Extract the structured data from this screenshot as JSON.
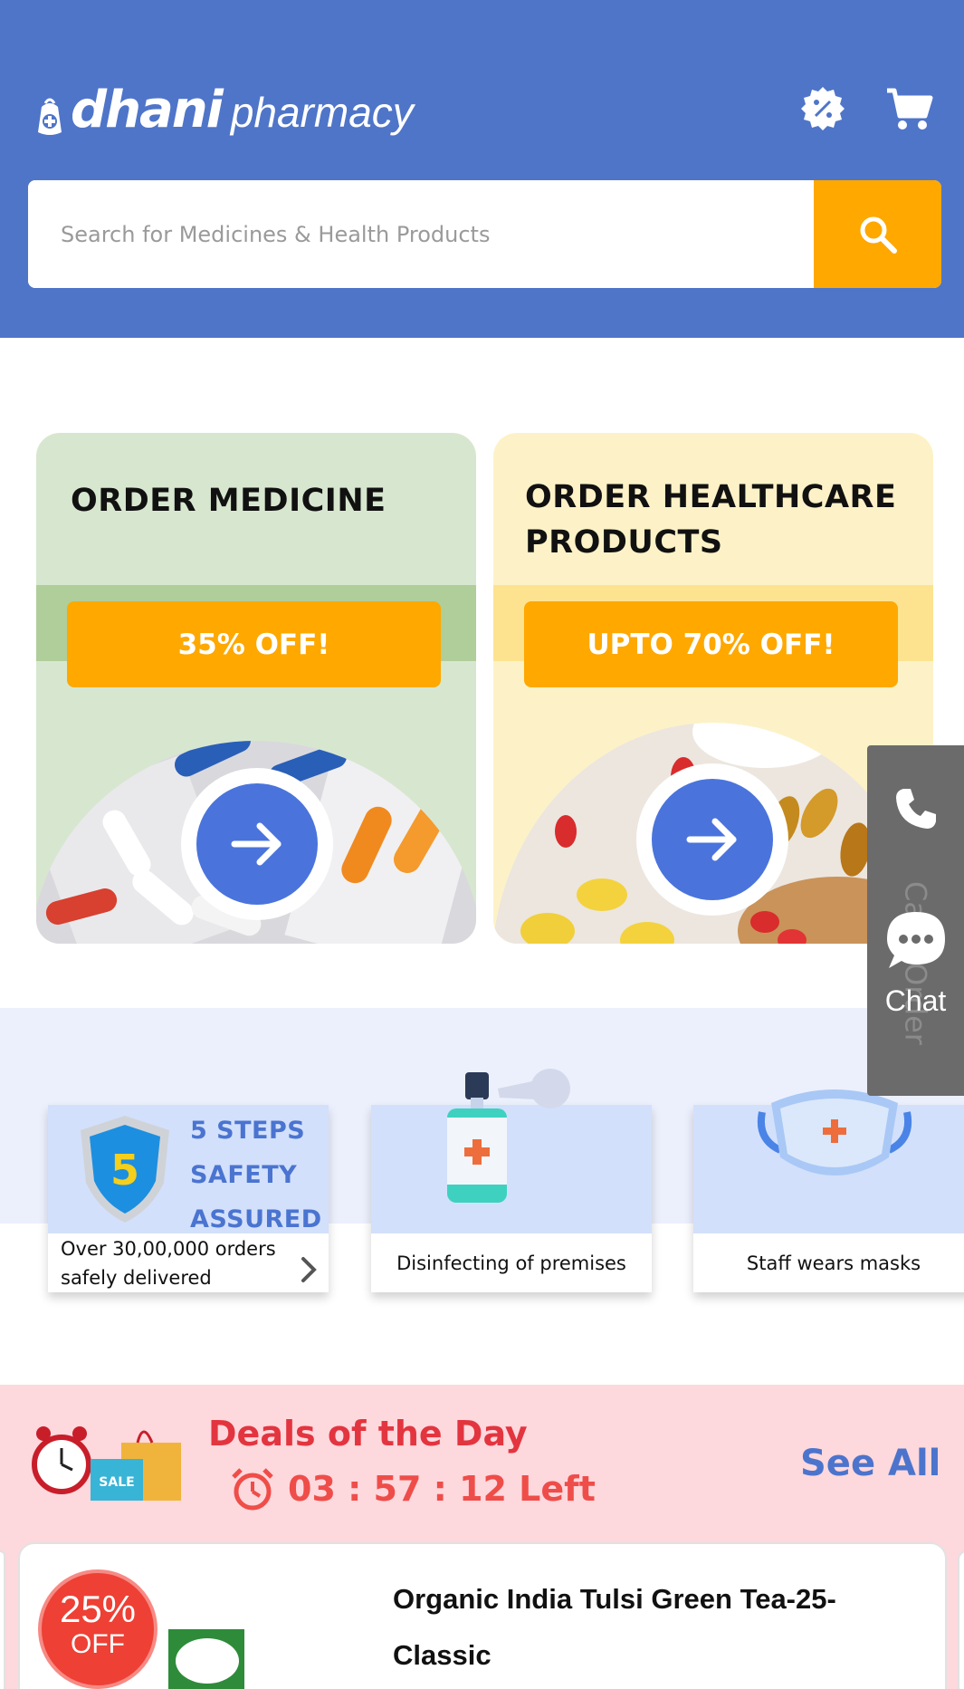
{
  "brand": {
    "name": "dhani",
    "suffix": "pharmacy",
    "header_color": "#4f75c9",
    "accent_color": "#fea800"
  },
  "header": {
    "icons": [
      "offer-badge-icon",
      "cart-icon"
    ]
  },
  "search": {
    "placeholder": "Search for Medicines & Health Products",
    "value": ""
  },
  "categories": [
    {
      "title": "ORDER MEDICINE",
      "offer": "35% OFF!",
      "bg": "#d7e7cf"
    },
    {
      "title": "ORDER HEALTHCARE PRODUCTS",
      "offer": "UPTO 70% OFF!",
      "bg": "#fdf2c7"
    }
  ],
  "side_widget": {
    "call_label": "Call",
    "order_label": "Order",
    "chat_label": "Chat"
  },
  "safety": {
    "badge_number": "5",
    "headline_lines": [
      "5 STEPS",
      "SAFETY",
      "ASSURED"
    ],
    "cards": [
      {
        "caption": "Over 30,00,000 orders safely delivered"
      },
      {
        "caption": "Disinfecting of premises"
      },
      {
        "caption": "Staff wears masks"
      }
    ]
  },
  "deals": {
    "title": "Deals of the Day",
    "timer": "03 : 57 : 12 Left",
    "see_all": "See All",
    "product": {
      "discount_pct": "25%",
      "discount_label": "OFF",
      "name": "Organic India Tulsi Green Tea-25-Classic"
    }
  }
}
